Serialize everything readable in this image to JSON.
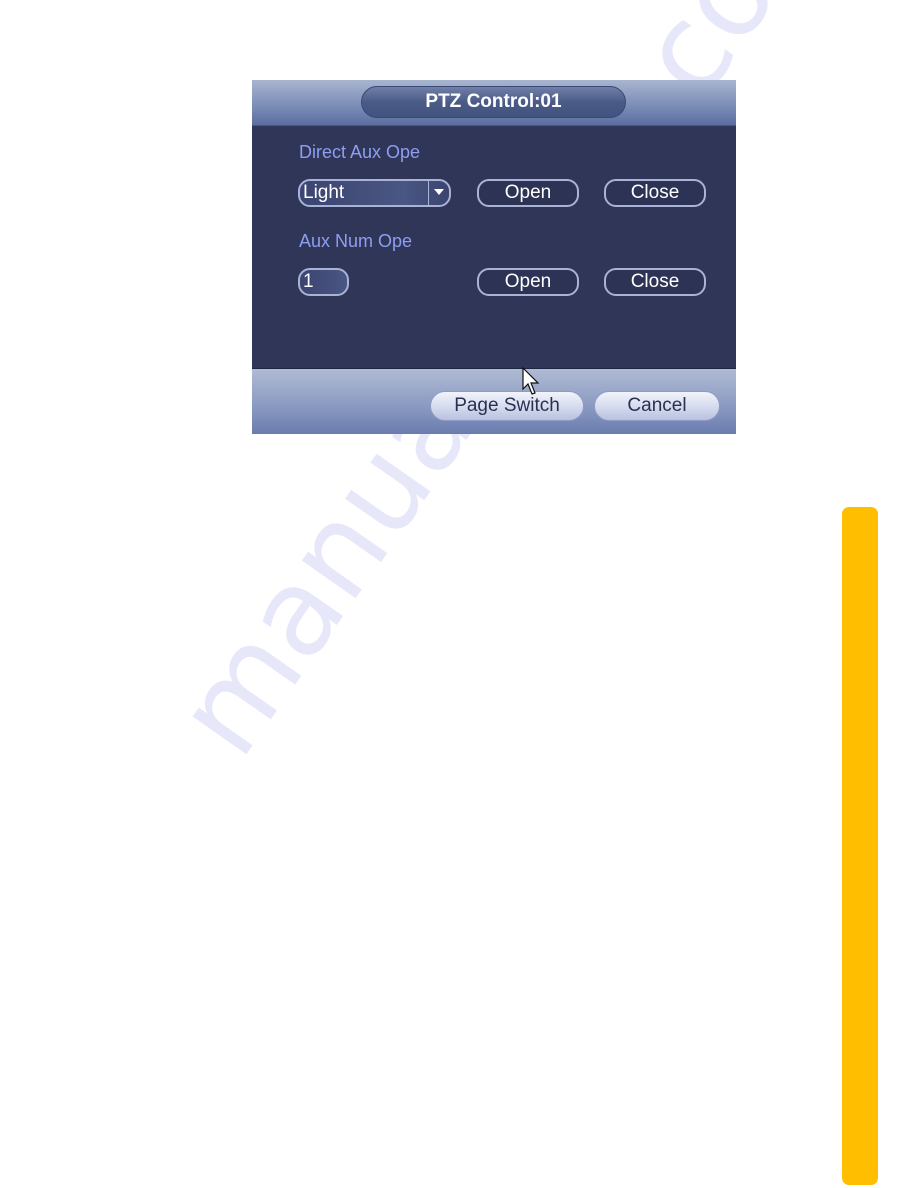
{
  "watermark": "manualshive.com",
  "dialog": {
    "title": "PTZ Control:01",
    "direct_aux": {
      "label": "Direct Aux Ope",
      "select_value": "Light",
      "open_label": "Open",
      "close_label": "Close"
    },
    "aux_num": {
      "label": "Aux Num Ope",
      "input_value": "1",
      "open_label": "Open",
      "close_label": "Close"
    },
    "footer": {
      "page_switch_label": "Page Switch",
      "cancel_label": "Cancel"
    }
  },
  "colors": {
    "dialog_bg": "#2f3657",
    "label_color": "#8e9ef0",
    "side_tab": "#ffbf00"
  }
}
